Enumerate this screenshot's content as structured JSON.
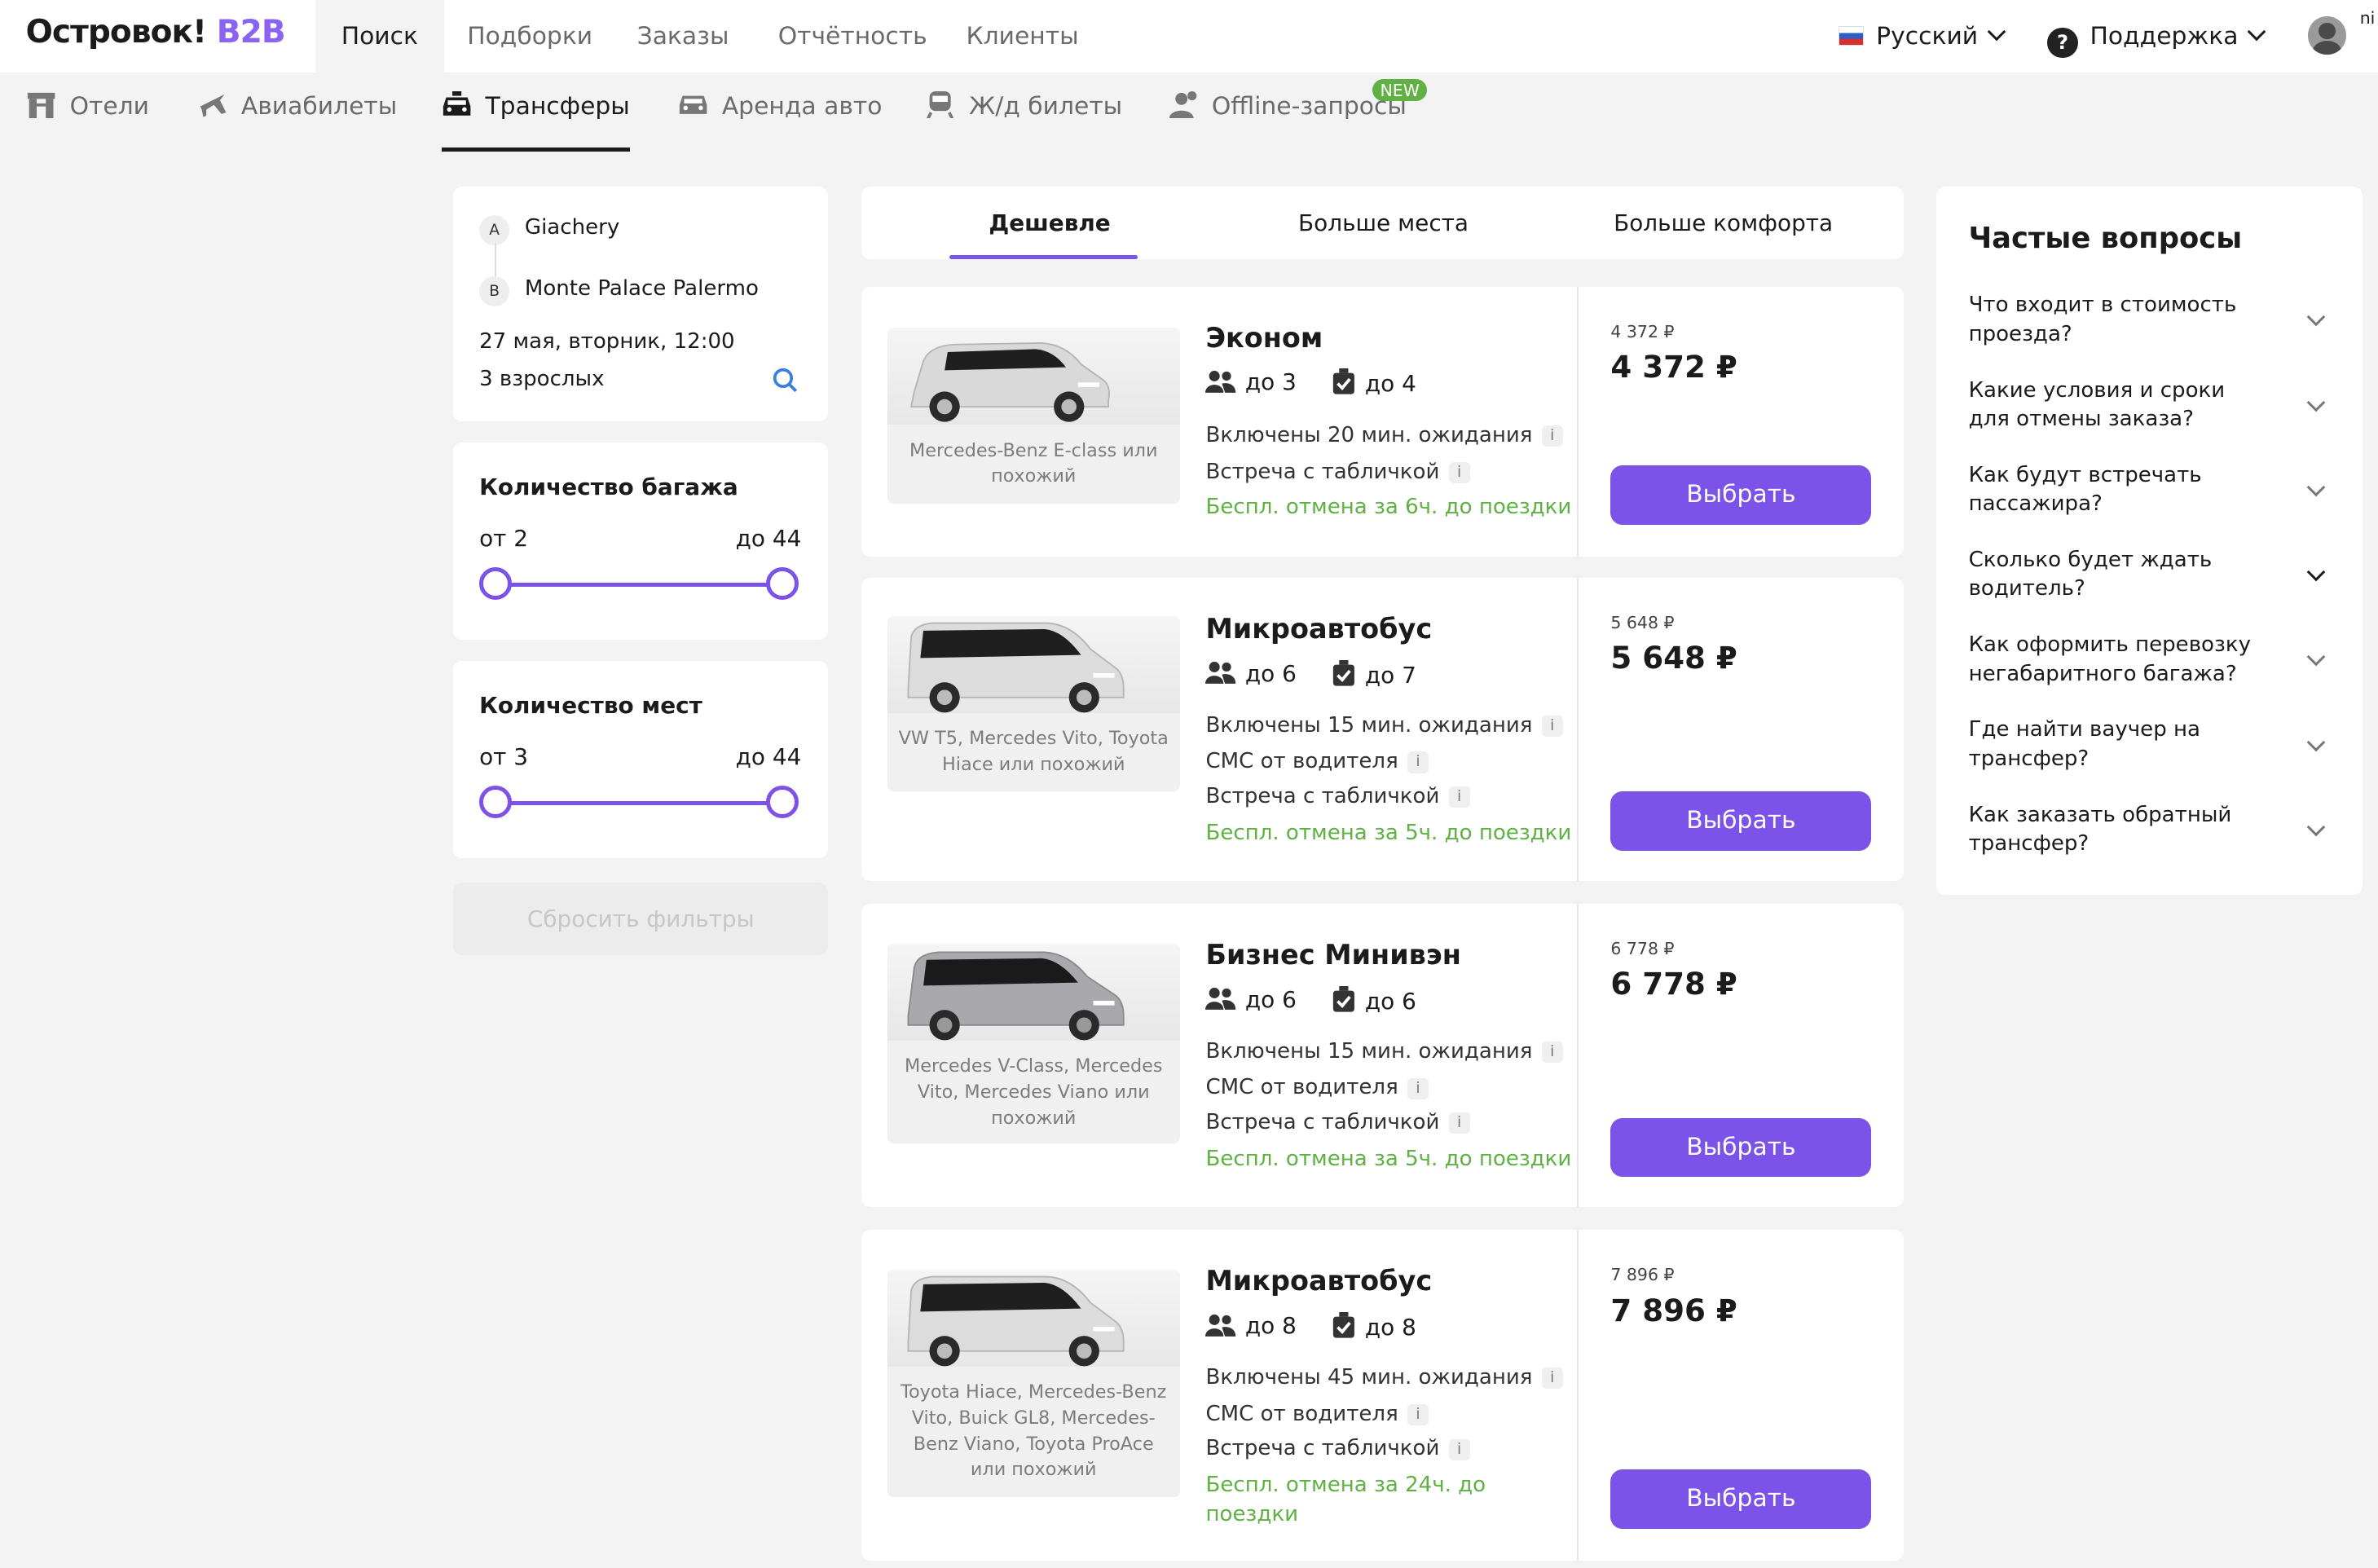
{
  "header": {
    "logo_main": "Островок!",
    "logo_sub": "B2B",
    "nav": [
      "Поиск",
      "Подборки",
      "Заказы",
      "Отчётность",
      "Клиенты"
    ],
    "language": "Русский",
    "support": "Поддержка",
    "user_fragment": "ni"
  },
  "product_tabs": [
    "Отели",
    "Авиабилеты",
    "Трансферы",
    "Аренда авто",
    "Ж/д билеты",
    "Offline-запросы"
  ],
  "new_badge": "NEW",
  "search": {
    "point_a_label": "A",
    "point_a": "Giachery",
    "point_b_label": "B",
    "point_b": "Monte Palace Palermo",
    "datetime": "27 мая, вторник, 12:00",
    "passengers": "3 взрослых"
  },
  "filters": {
    "luggage": {
      "title": "Количество багажа",
      "from_label": "от 2",
      "to_label": "до 44",
      "min": 2,
      "max": 44
    },
    "seats": {
      "title": "Количество мест",
      "from_label": "от 3",
      "to_label": "до 44",
      "min": 3,
      "max": 44
    },
    "reset_label": "Сбросить фильтры"
  },
  "sort_tabs": [
    "Дешевле",
    "Больше места",
    "Больше комфорта"
  ],
  "offers": [
    {
      "title": "Эконом",
      "car_caption": "Mercedes-Benz E-class или похожий",
      "passengers": "до 3",
      "luggage": "до 4",
      "features": [
        "Включены 20 мин. ожидания",
        "Встреча с табличкой"
      ],
      "cancel": "Беспл. отмена за 6ч. до поездки",
      "price_small": "4 372 ₽",
      "price": "4 372 ₽",
      "button": "Выбрать"
    },
    {
      "title": "Микроавтобус",
      "car_caption": "VW T5, Mercedes Vito, Toyota Hiace или похожий",
      "passengers": "до 6",
      "luggage": "до 7",
      "features": [
        "Включены 15 мин. ожидания",
        "СМС от водителя",
        "Встреча с табличкой"
      ],
      "cancel": "Беспл. отмена за 5ч. до поездки",
      "price_small": "5 648 ₽",
      "price": "5 648 ₽",
      "button": "Выбрать"
    },
    {
      "title": "Бизнес Минивэн",
      "car_caption": "Mercedes V-Class, Mercedes Vito, Mercedes Viano или похожий",
      "passengers": "до 6",
      "luggage": "до 6",
      "features": [
        "Включены 15 мин. ожидания",
        "СМС от водителя",
        "Встреча с табличкой"
      ],
      "cancel": "Беспл. отмена за 5ч. до поездки",
      "price_small": "6 778 ₽",
      "price": "6 778 ₽",
      "button": "Выбрать"
    },
    {
      "title": "Микроавтобус",
      "car_caption": "Toyota Hiace, Mercedes-Benz Vito, Buick GL8, Mercedes-Benz Viano, Toyota ProAce или похожий",
      "passengers": "до 8",
      "luggage": "до 8",
      "features": [
        "Включены 45 мин. ожидания",
        "СМС от водителя",
        "Встреча с табличкой"
      ],
      "cancel": "Беспл. отмена за 24ч. до поездки",
      "price_small": "7 896 ₽",
      "price": "7 896 ₽",
      "button": "Выбрать"
    }
  ],
  "faq": {
    "title": "Частые вопросы",
    "items": [
      "Что входит в стоимость проезда?",
      "Какие условия и сроки для отмены заказа?",
      "Как будут встречать пассажира?",
      "Сколько будет ждать водитель?",
      "Как оформить перевозку негабаритного багажа?",
      "Где найти ваучер на трансфер?",
      "Как заказать обратный трансфер?"
    ]
  },
  "colors": {
    "accent": "#7b53e8",
    "success": "#5fb143",
    "background": "#f3f3f3"
  }
}
